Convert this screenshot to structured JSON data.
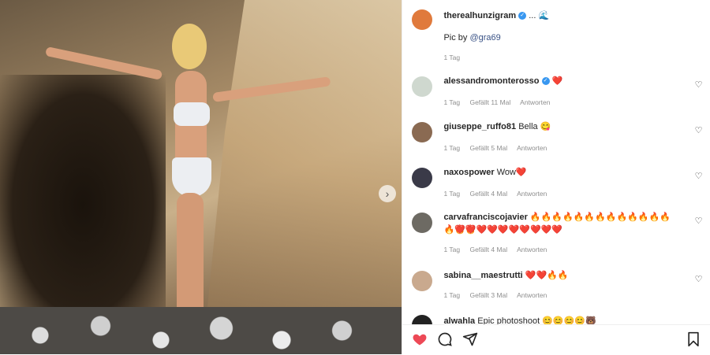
{
  "post": {
    "author": "therealhunzigram",
    "author_suffix": "...",
    "wave_icon": "🌊",
    "caption_prefix": "Pic by ",
    "caption_mention": "@gra69",
    "time": "1 Tag"
  },
  "comments": [
    {
      "user": "alessandromonterosso",
      "verified": true,
      "text": "❤️",
      "time": "1 Tag",
      "likes": "Gefällt 11 Mal",
      "reply": "Antworten",
      "avatar_color": "#cfd8cf"
    },
    {
      "user": "giuseppe_ruffo81",
      "verified": false,
      "text": "Bella 😋",
      "time": "1 Tag",
      "likes": "Gefällt 5 Mal",
      "reply": "Antworten",
      "avatar_color": "#8a6a52"
    },
    {
      "user": "naxospower",
      "verified": false,
      "text": "Wow❤️",
      "time": "1 Tag",
      "likes": "Gefällt 4 Mal",
      "reply": "Antworten",
      "avatar_color": "#3a3a48"
    },
    {
      "user": "carvafranciscojavier",
      "verified": false,
      "text": "🔥🔥🔥🔥🔥🔥🔥🔥🔥🔥🔥🔥🔥🔥🔥🔥",
      "text2": "🔥❤️❤️❤️❤️❤️❤️❤️❤️❤️❤️",
      "time": "1 Tag",
      "likes": "Gefällt 4 Mal",
      "reply": "Antworten",
      "avatar_color": "#6d6a63"
    },
    {
      "user": "sabina__maestrutti",
      "verified": false,
      "text": "❤️❤️🔥🔥",
      "time": "1 Tag",
      "likes": "Gefällt 3 Mal",
      "reply": "Antworten",
      "avatar_color": "#c9a98e"
    },
    {
      "user": "alwahla",
      "verified": false,
      "text": "Epic photoshoot 😊😊😊😊🐻",
      "avatar_color": "#222222"
    }
  ],
  "colors": {
    "like_red": "#ed4956",
    "text": "#262626",
    "muted": "#8e8e8e"
  },
  "icons": {
    "heart_outline": "♡",
    "next": "›",
    "comment": "💬",
    "share": "➤",
    "bookmark": "🔖"
  }
}
